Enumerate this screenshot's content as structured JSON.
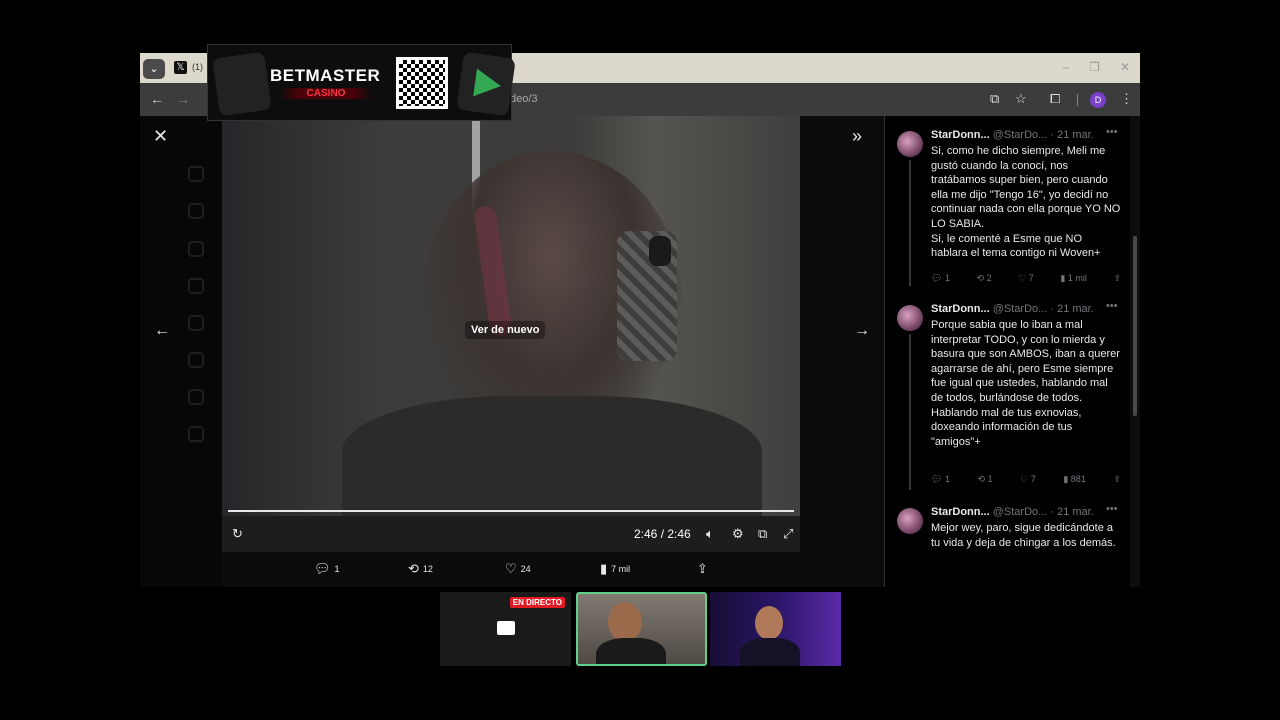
{
  "browser": {
    "tab_count": "(1)",
    "url": "deo/3",
    "profile_initial": "D"
  },
  "ad": {
    "brand": "BETMASTER",
    "sub": "CASINO"
  },
  "video": {
    "replay_label": "Ver de nuevo",
    "time": "2:46 / 2:46",
    "progress": 1.0
  },
  "post_actions": {
    "replies": "1",
    "reposts": "12",
    "likes": "24",
    "views": "7 mil"
  },
  "replies": [
    {
      "name": "StarDonn...",
      "handle": "@StarDo...",
      "date": "· 21 mar.",
      "text": "Si, como he dicho siempre, Meli me gustó cuando la conocí, nos tratábamos super bien, pero cuando ella me dijo \"Tengo 16\", yo decidí no continuar nada con ella porque YO NO LO SABIA.\nSi, le comenté a Esme que NO hablara el tema contigo ni Woven+",
      "replies": "1",
      "reposts": "2",
      "likes": "7",
      "views": "1 mil"
    },
    {
      "name": "StarDonn...",
      "handle": "@StarDo...",
      "date": "· 21 mar.",
      "text": "Porque sabia que lo iban a mal interpretar TODO, y con lo mierda y basura que son AMBOS, iban a querer agarrarse de ahí, pero Esme siempre fue igual que ustedes, hablando mal de todos, burlándose de todos.\nHablando mal de tus exnovias, doxeando información de tus \"amigos\"+",
      "replies": "1",
      "reposts": "1",
      "likes": "7",
      "views": "881"
    },
    {
      "name": "StarDonn...",
      "handle": "@StarDo...",
      "date": "· 21 mar.",
      "text": "Mejor wey, paro, sigue dedicándote a tu vida y deja de chingar a los demás."
    }
  ],
  "stream": {
    "live_label": "EN DIRECTO"
  },
  "colors": {
    "accent_live": "#e01b24",
    "cam_border": "#5fd08c",
    "profile": "#7b3fc9"
  }
}
